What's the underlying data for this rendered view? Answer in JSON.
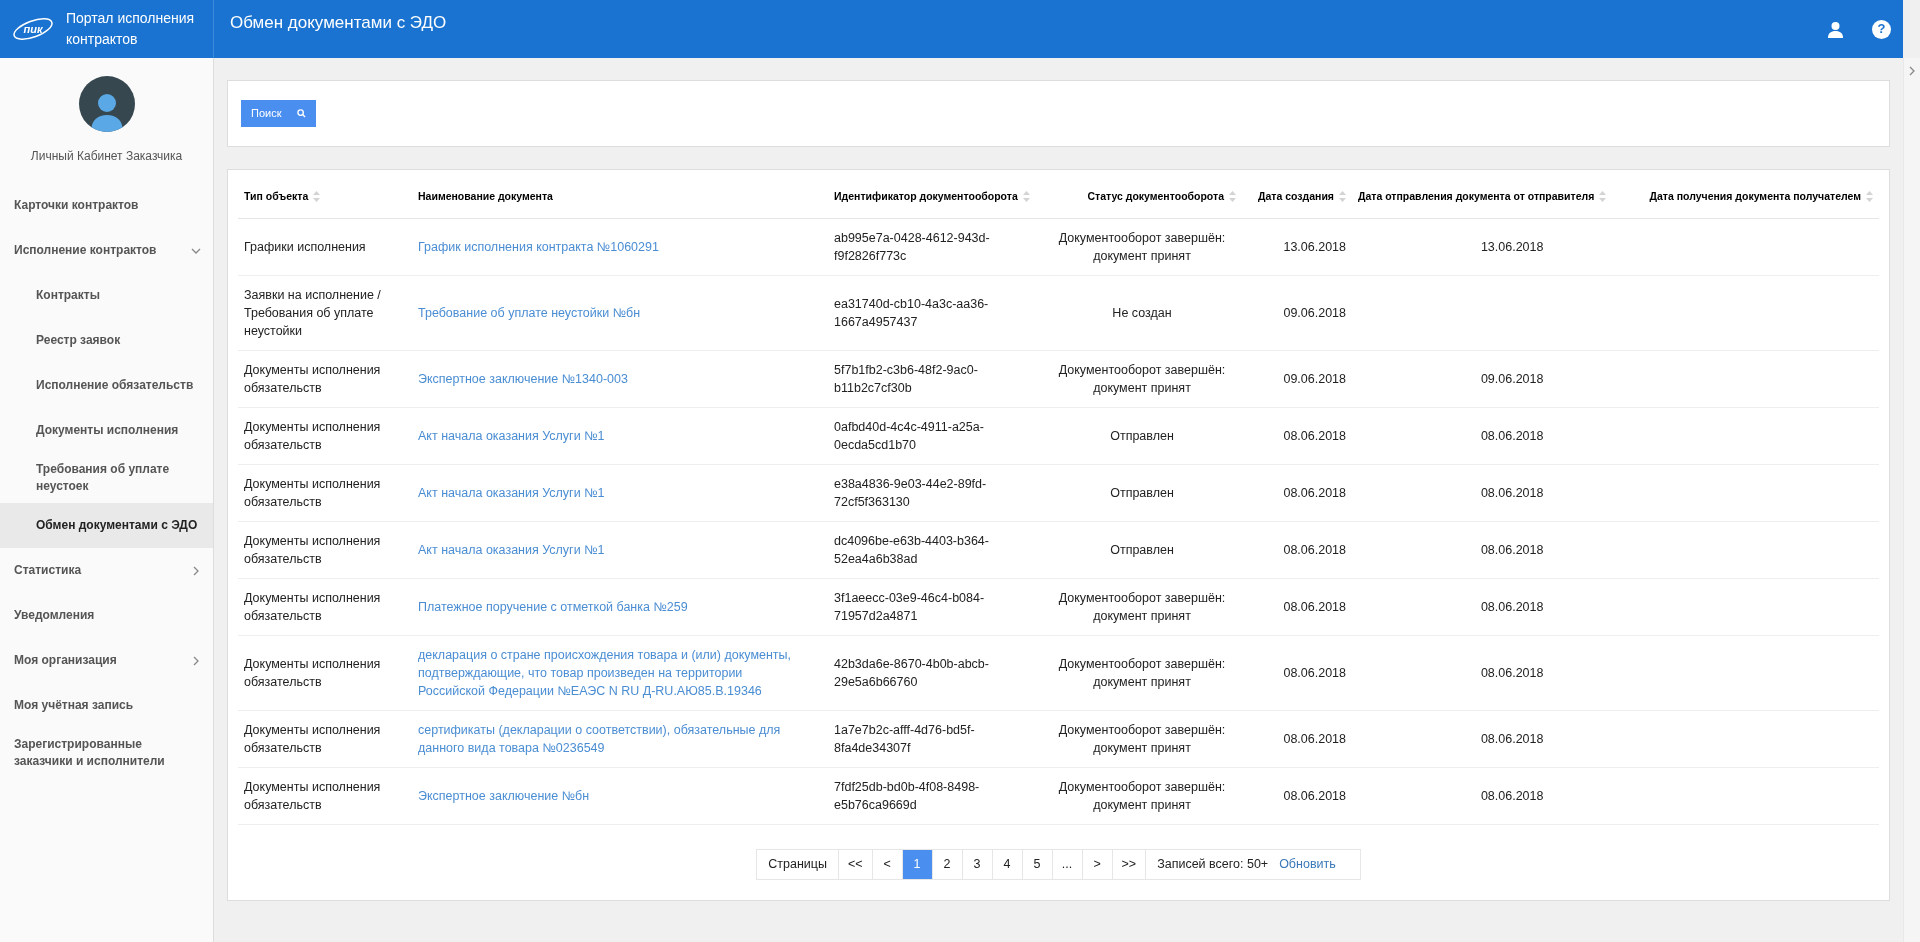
{
  "header": {
    "logo_text": "пик",
    "portal_title": "Портал исполнения контрактов",
    "page_title": "Обмен документами с ЭДО",
    "help_label": "?"
  },
  "sidebar": {
    "user_caption": "Личный Кабинет Заказчика",
    "items": [
      {
        "label": "Карточки контрактов",
        "selected": false
      },
      {
        "label": "Исполнение контрактов",
        "selected": false,
        "expanded": true,
        "children": [
          {
            "label": "Контракты",
            "selected": false
          },
          {
            "label": "Реестр заявок",
            "selected": false
          },
          {
            "label": "Исполнение обязательств",
            "selected": false
          },
          {
            "label": "Документы исполнения",
            "selected": false
          },
          {
            "label": "Требования об уплате неустоек",
            "selected": false
          },
          {
            "label": "Обмен документами с ЭДО",
            "selected": true
          }
        ]
      },
      {
        "label": "Статистика",
        "selected": false,
        "expanded": false
      },
      {
        "label": "Уведомления",
        "selected": false
      },
      {
        "label": "Моя организация",
        "selected": false,
        "expanded": false
      },
      {
        "label": "Моя учётная запись",
        "selected": false
      },
      {
        "label": "Зарегистрированные заказчики и исполнители",
        "selected": false
      }
    ]
  },
  "search_button": "Поиск",
  "table": {
    "columns": [
      {
        "label": "Тип объекта",
        "sortable": true
      },
      {
        "label": "Наименование документа",
        "sortable": false
      },
      {
        "label": "Идентификатор документооборота",
        "sortable": true
      },
      {
        "label": "Статус документооборота",
        "sortable": true
      },
      {
        "label": "Дата создания",
        "sortable": true
      },
      {
        "label": "Дата отправления документа от отправителя",
        "sortable": true
      },
      {
        "label": "Дата получения документа получателем",
        "sortable": true
      }
    ],
    "rows": [
      {
        "type": "Графики исполнения",
        "name": "График исполнения контракта №1060291",
        "id": "ab995e7a-0428-4612-943d-f9f2826f773c",
        "status": "Документооборот завершён: документ принят",
        "created": "13.06.2018",
        "sent": "13.06.2018"
      },
      {
        "type": "Заявки на исполнение / Требования об уплате неустойки",
        "name": "Требование об уплате неустойки №бн",
        "id": "ea31740d-cb10-4a3c-aa36-1667a4957437",
        "status": "Не создан",
        "created": "09.06.2018"
      },
      {
        "type": "Документы исполнения обязательств",
        "name": "Экспертное заключение №1340-003",
        "id": "5f7b1fb2-c3b6-48f2-9ac0-b11b2c7cf30b",
        "status": "Документооборот завершён: документ принят",
        "created": "09.06.2018",
        "sent": "09.06.2018"
      },
      {
        "type": "Документы исполнения обязательств",
        "name": "Акт начала оказания Услуги №1",
        "id": "0afbd40d-4c4c-4911-a25a-0ecda5cd1b70",
        "status": "Отправлен",
        "created": "08.06.2018",
        "sent": "08.06.2018"
      },
      {
        "type": "Документы исполнения обязательств",
        "name": "Акт начала оказания Услуги №1",
        "id": "e38a4836-9e03-44e2-89fd-72cf5f363130",
        "status": "Отправлен",
        "created": "08.06.2018",
        "sent": "08.06.2018"
      },
      {
        "type": "Документы исполнения обязательств",
        "name": "Акт начала оказания Услуги №1",
        "id": "dc4096be-e63b-4403-b364-52ea4a6b38ad",
        "status": "Отправлен",
        "created": "08.06.2018",
        "sent": "08.06.2018"
      },
      {
        "type": "Документы исполнения обязательств",
        "name": "Платежное поручение с отметкой банка №259",
        "id": "3f1aeecc-03e9-46c4-b084-71957d2a4871",
        "status": "Документооборот завершён: документ принят",
        "created": "08.06.2018",
        "sent": "08.06.2018"
      },
      {
        "type": "Документы исполнения обязательств",
        "name": "декларация о стране происхождения товара и (или) документы, подтверждающие, что товар произведен на территории Российской Федерации №ЕАЭС N RU Д-RU.АЮ85.В.19346",
        "id": "42b3da6e-8670-4b0b-abcb-29e5a6b66760",
        "status": "Документооборот завершён: документ принят",
        "created": "08.06.2018",
        "sent": "08.06.2018"
      },
      {
        "type": "Документы исполнения обязательств",
        "name": "сертификаты (декларации о соответствии), обязательные для данного вида товара №0236549",
        "id": "1a7e7b2c-afff-4d76-bd5f-8fa4de34307f",
        "status": "Документооборот завершён: документ принят",
        "created": "08.06.2018",
        "sent": "08.06.2018"
      },
      {
        "type": "Документы исполнения обязательств",
        "name": "Экспертное заключение №бн",
        "id": "7fdf25db-bd0b-4f08-8498-e5b76ca9669d",
        "status": "Документооборот завершён: документ принят",
        "created": "08.06.2018",
        "sent": "08.06.2018"
      }
    ]
  },
  "pagination": {
    "label": "Страницы",
    "pages": [
      {
        "label": "<<",
        "selected": false
      },
      {
        "label": "<",
        "selected": false
      },
      {
        "label": "1",
        "selected": true
      },
      {
        "label": "2",
        "selected": false
      },
      {
        "label": "3",
        "selected": false
      },
      {
        "label": "4",
        "selected": false
      },
      {
        "label": "5",
        "selected": false
      },
      {
        "label": "...",
        "selected": false
      },
      {
        "label": ">",
        "selected": false
      },
      {
        "label": ">>",
        "selected": false
      }
    ],
    "total": "Записей всего: 50+",
    "refresh": "Обновить"
  }
}
